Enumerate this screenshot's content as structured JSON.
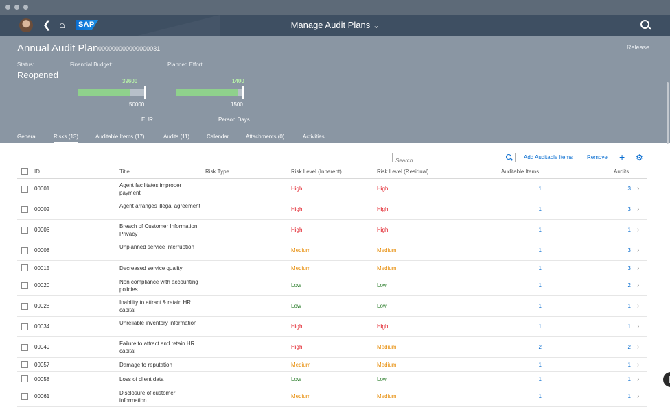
{
  "window": {
    "dots": 3
  },
  "shell": {
    "title": "Manage Audit Plans",
    "logo": "SAP",
    "icons": [
      "avatar",
      "back-icon",
      "home-icon",
      "search-icon"
    ]
  },
  "header": {
    "title": "Annual Audit Plan",
    "object_id": "000000000000000031",
    "release_label": "Release",
    "status_label": "Status:",
    "status_value": "Reopened",
    "budget_label": "Financial Budget:",
    "budget_value": "39600",
    "budget_max": "50000",
    "budget_unit": "EUR",
    "budget_fraction": 0.792,
    "effort_label": "Planned Effort:",
    "effort_value": "1400",
    "effort_max": "1500",
    "effort_unit": "Person Days",
    "effort_fraction": 0.933
  },
  "tabs": [
    "General",
    "Risks (13)",
    "Auditable Items (17)",
    "Audits (11)",
    "Calendar",
    "Attachments (0)",
    "Activities"
  ],
  "active_tab": 1,
  "toolbar": {
    "search_placeholder": "Search",
    "add_label": "Add Auditable Items",
    "remove_label": "Remove",
    "add_icon": "plus-icon",
    "settings_icon": "gear-icon"
  },
  "table": {
    "columns": [
      "ID",
      "Title",
      "Risk Type",
      "Risk Level (Inherent)",
      "Risk Level (Residual)",
      "Auditable Items",
      "Audits"
    ],
    "rows": [
      {
        "id": "00001",
        "title": "Agent facilitates improper payment",
        "inherent": "High",
        "residual": "High",
        "items": "1",
        "audits": "3"
      },
      {
        "id": "00002",
        "title": "Agent arranges illegal agreement",
        "inherent": "High",
        "residual": "High",
        "items": "1",
        "audits": "3"
      },
      {
        "id": "00006",
        "title": "Breach of Customer Information Privacy",
        "inherent": "High",
        "residual": "High",
        "items": "1",
        "audits": "1"
      },
      {
        "id": "00008",
        "title": "Unplanned service Interruption",
        "inherent": "Medium",
        "residual": "Medium",
        "items": "1",
        "audits": "3"
      },
      {
        "id": "00015",
        "title": "Decreased service quality",
        "inherent": "Medium",
        "residual": "Medium",
        "items": "1",
        "audits": "3"
      },
      {
        "id": "00020",
        "title": "Non compliance with accounting policies",
        "inherent": "Low",
        "residual": "Low",
        "items": "1",
        "audits": "2"
      },
      {
        "id": "00028",
        "title": "Inability to attract & retain HR capital",
        "inherent": "Low",
        "residual": "Low",
        "items": "1",
        "audits": "1"
      },
      {
        "id": "00034",
        "title": "Unreliable inventory information",
        "inherent": "High",
        "residual": "High",
        "items": "1",
        "audits": "1"
      },
      {
        "id": "00049",
        "title": "Failure to attract and retain HR capital",
        "inherent": "High",
        "residual": "Medium",
        "items": "2",
        "audits": "2"
      },
      {
        "id": "00057",
        "title": "Damage to reputation",
        "inherent": "Medium",
        "residual": "Medium",
        "items": "1",
        "audits": "1"
      },
      {
        "id": "00058",
        "title": "Loss of client data",
        "inherent": "Low",
        "residual": "Low",
        "items": "1",
        "audits": "1"
      },
      {
        "id": "00061",
        "title": "Disclosure of customer information",
        "inherent": "Medium",
        "residual": "Medium",
        "items": "1",
        "audits": "1"
      }
    ]
  }
}
